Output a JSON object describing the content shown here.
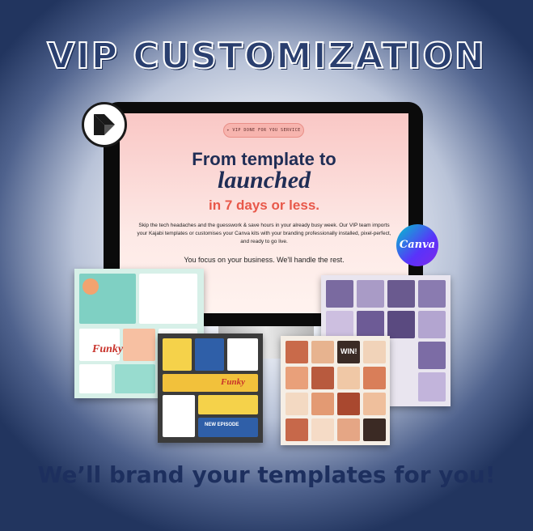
{
  "headline": "VIP CUSTOMIZATION",
  "tagline": "We’ll brand your templates for you!",
  "screen": {
    "pill": "✦ VIP DONE FOR YOU SERVICE",
    "line1": "From template to",
    "line2": "launched",
    "line3": "in 7 days or less.",
    "body": "Skip the tech headaches and the guesswork & save hours in your already busy week. Our VIP team imports your Kajabi templates or customises your Canva kits with your branding professionally installed, pixel-perfect, and ready to go live.",
    "focus": "You focus on your business. We'll handle the rest."
  },
  "logos": {
    "canva": "Canva",
    "kajabi_icon": "kajabi-logo-icon"
  },
  "mockups": {
    "mint_brand": "Funky",
    "dark_brand": "Funky",
    "dark_banner": "NEW EPISODE",
    "peach_badge": "WIN!"
  },
  "colors": {
    "navy": "#1d2f5e",
    "coral": "#e8584a",
    "screen_pink": "#f9c7c5",
    "canva_teal": "#00c4cc",
    "canva_purple": "#7d2ae8"
  }
}
